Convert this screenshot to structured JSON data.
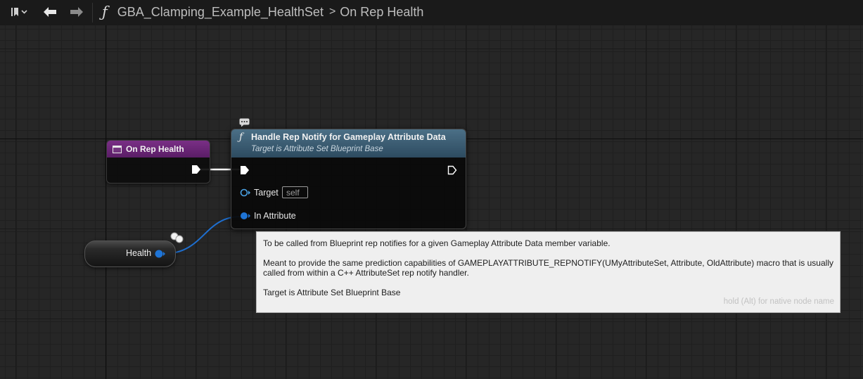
{
  "toolbar": {
    "bookmark_icon": "bookmark-icon",
    "back_icon": "arrow-left-icon",
    "forward_icon": "arrow-right-icon",
    "function_glyph": "ƒ",
    "breadcrumb": [
      "GBA_Clamping_Example_HealthSet",
      "On Rep Health"
    ],
    "breadcrumb_separator": ">"
  },
  "nodes": {
    "event": {
      "title": "On Rep Health",
      "header_color": "#6b2679"
    },
    "function": {
      "glyph": "ƒ",
      "title": "Handle Rep Notify for Gameplay Attribute Data",
      "subtitle": "Target is Attribute Set Blueprint Base",
      "header_color": "#3f6379",
      "pins": {
        "target_label": "Target",
        "target_default": "self",
        "attribute_label": "In Attribute"
      }
    },
    "variable": {
      "label": "Health",
      "pin_color": "#1e74d6"
    }
  },
  "tooltip": {
    "line1": "To be called from Blueprint rep notifies for a given Gameplay Attribute Data member variable.",
    "line2": "Meant to provide the same prediction capabilities of GAMEPLAYATTRIBUTE_REPNOTIFY(UMyAttributeSet, Attribute, OldAttribute) macro that is usually called from within a C++ AttributeSet rep notify handler.",
    "line3": "Target is Attribute Set Blueprint Base",
    "hint": "hold (Alt) for native node name"
  },
  "colors": {
    "struct_pin": "#1e74d6",
    "target_pin": "#4aa3e6",
    "exec_wire": "#ffffff"
  }
}
